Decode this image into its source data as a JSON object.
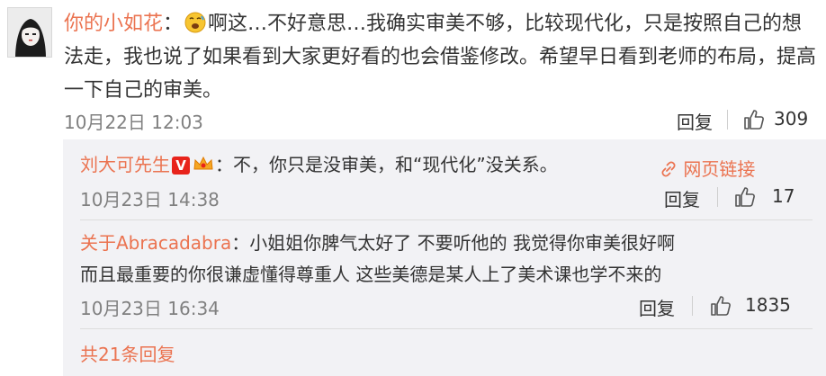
{
  "comment": {
    "username": "你的小如花",
    "emoji": "embarrassed-face",
    "text": "啊这…不好意思…我确实审美不够，比较现代化，只是按照自己的想法走，我也说了如果看到大家更好看的也会借鉴修改。希望早日看到老师的布局，提高一下自己的审美。",
    "time": "10月22日 12:03",
    "reply_label": "回复",
    "likes": "309"
  },
  "replies": [
    {
      "username": "刘大可先生",
      "verified_badge": "V",
      "text": "：不，你只是没审美，和“现代化”没关系。",
      "link_label": "网页链接",
      "time": "10月23日 14:38",
      "reply_label": "回复",
      "likes": "17"
    },
    {
      "username": "关于Abracadabra",
      "text_line1": "：小姐姐你脾气太好了 不要听他的 我觉得你审美很好啊",
      "text_line2": "而且最重要的你很谦虚懂得尊重人 这些美德是某人上了美术课也学不来的",
      "time": "10月23日 16:34",
      "reply_label": "回复",
      "likes": "1835"
    }
  ],
  "total_replies": "共21条回复",
  "colors": {
    "link": "#eb7350",
    "reply_bg": "#f2f2f5",
    "muted": "#808080"
  }
}
